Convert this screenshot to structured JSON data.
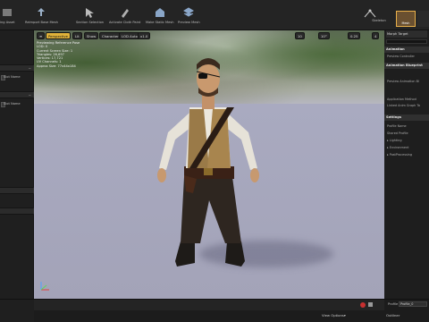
{
  "toolbar": {
    "items": [
      {
        "label": "ing Asset",
        "icon": "asset-icon"
      },
      {
        "label": "Reimport Base Mesh",
        "icon": "reimport-icon"
      },
      {
        "label": "Section Selection",
        "icon": "section-select-icon"
      },
      {
        "label": "Activate Cloth Paint",
        "icon": "cloth-paint-icon"
      },
      {
        "label": "Make Static Mesh",
        "icon": "static-mesh-icon"
      },
      {
        "label": "Preview Mesh",
        "icon": "preview-mesh-icon"
      }
    ],
    "modes": {
      "skeleton": "Skeleton",
      "mesh": "Mesh"
    }
  },
  "left_panel": {
    "slot_name_1": "Slot Name",
    "slot_name_2": "Slot Name",
    "collapse_1": "−",
    "collapse_2": "−"
  },
  "viewport": {
    "toolbar_left": [
      "≡",
      "Perspective",
      "Lit",
      "Show",
      "Character",
      "LOD Auto",
      "x1.0"
    ],
    "toolbar_right": [
      "10",
      "10°",
      "0.25",
      "4"
    ],
    "stats": [
      "Previewing Reference Pose",
      "LOD: 0",
      "Current Screen Size: 1",
      "Triangles: 26,697",
      "Vertices: 17,721",
      "UV Channels: 1",
      "Approx Size: 77x44x184"
    ]
  },
  "right_panel": {
    "tab": "Morph Target",
    "sections": {
      "animation": "Animation",
      "animation_blueprint": "Animation Blueprint",
      "settings": "Settings"
    },
    "rows": {
      "preview_controller": "Preview Controller",
      "preview_anim_bp": "Preview Animation Bl",
      "application_method": "Application Method",
      "linked_anim_graph_tag": "Linked Anim Graph Ta",
      "profile_name": "Profile Name",
      "shared_profile": "Shared Profile",
      "lighting": "▸ Lighting",
      "environment": "▸ Environment",
      "postprocessing": "▸ PostProcessing"
    }
  },
  "bottom": {
    "view_options": "View Options▾",
    "outliner": "Outliner",
    "profile_label": "Profile",
    "profile_value": "Profile_0"
  },
  "colors": {
    "accent": "#e0b23a",
    "panel": "#1e1e1e",
    "viewport_floor": "#a8a8bc"
  }
}
